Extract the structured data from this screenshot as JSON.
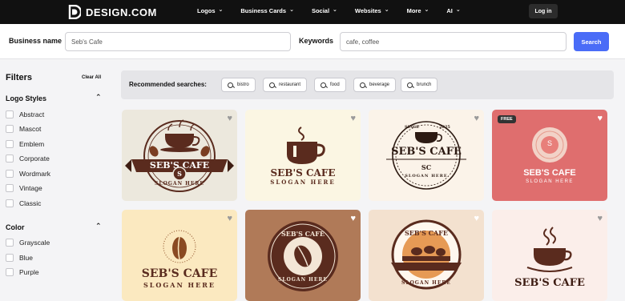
{
  "brand": {
    "name": "DESIGN.COM"
  },
  "nav": {
    "items": [
      {
        "label": "Logos"
      },
      {
        "label": "Business Cards"
      },
      {
        "label": "Social"
      },
      {
        "label": "Websites"
      },
      {
        "label": "More"
      },
      {
        "label": "AI"
      }
    ],
    "login_label": "Log in"
  },
  "search": {
    "business_name_label": "Business name",
    "business_name_value": "Seb's Cafe",
    "keywords_label": "Keywords",
    "keywords_value": "cafe, coffee",
    "button_label": "Search"
  },
  "filters": {
    "title": "Filters",
    "clear_all": "Clear All",
    "logo_styles": {
      "title": "Logo Styles",
      "options": [
        "Abstract",
        "Mascot",
        "Emblem",
        "Corporate",
        "Wordmark",
        "Vintage",
        "Classic"
      ]
    },
    "color": {
      "title": "Color",
      "options": [
        "Grayscale",
        "Blue",
        "Purple"
      ]
    }
  },
  "recommended": {
    "label": "Recommended searches:",
    "chips": [
      "bistro",
      "restaurant",
      "food",
      "beverage",
      "brunch"
    ]
  },
  "cards": [
    {
      "name": "SEB'S CAFE",
      "initial": "S",
      "slogan": "SLOGAN HERE",
      "bg": "#ece8dd",
      "free": false
    },
    {
      "name": "SEB'S CAFE",
      "slogan": "SLOGAN HERE",
      "bg": "#fbf6e3",
      "free": false
    },
    {
      "name": "SEB'S CAFE",
      "initial": "SC",
      "slogan": "SLOGAN HERE",
      "since": "SINCE",
      "year": "2025",
      "bg": "#fbf3e9",
      "free": false
    },
    {
      "name": "SEB'S CAFE",
      "initial": "S",
      "slogan": "SLOGAN HERE",
      "bg": "#df6e6e",
      "free": true,
      "free_label": "FREE"
    },
    {
      "name": "SEB'S CAFE",
      "slogan": "SLOGAN HERE",
      "bg": "#fbe9c0",
      "free": false
    },
    {
      "name": "SEB'S CAFE",
      "slogan": "SLOGAN HERE",
      "bg": "#b07a58",
      "free": false
    },
    {
      "name": "SEB'S CAFE",
      "slogan": "SLOGAN HERE",
      "bg": "#f3e1cf",
      "free": false
    },
    {
      "name": "SEB'S CAFE",
      "bg": "#fbeeea",
      "free": false
    }
  ],
  "colors": {
    "accent": "#4a6cf7",
    "topbar": "#111111",
    "coffee_brown": "#5a2b1e"
  }
}
